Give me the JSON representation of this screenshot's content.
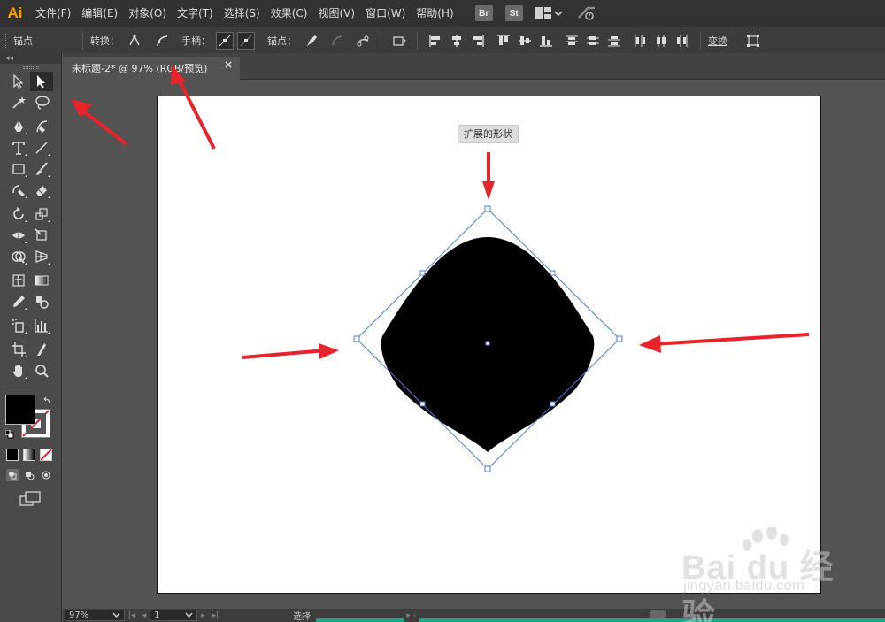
{
  "app": {
    "logo": "Ai"
  },
  "menu": [
    "文件(F)",
    "编辑(E)",
    "对象(O)",
    "文字(T)",
    "选择(S)",
    "效果(C)",
    "视图(V)",
    "窗口(W)",
    "帮助(H)"
  ],
  "bridge_buttons": [
    "Br",
    "St"
  ],
  "control_bar": {
    "mode_label": "锚点",
    "convert_label": "转换：",
    "handles_label": "手柄：",
    "anchors_label": "锚点：",
    "transform_label": "变换"
  },
  "document": {
    "tab_title": "未标题-2* @ 97% (RGB/预览)",
    "close_glyph": "×"
  },
  "tooltip": "扩展的形状",
  "status_bar": {
    "zoom": "97%",
    "artboard_num": "1",
    "tool_label": "选择"
  },
  "colors": {
    "accent": "#ff9a00",
    "arrow_red": "#e8232a",
    "selection_blue": "#4a7bd6",
    "fill": "#000000"
  },
  "icons": {
    "tools": [
      [
        "selection-arrow-icon",
        "direct-selection-icon"
      ],
      [
        "magic-wand-icon",
        "lasso-icon"
      ],
      [
        "pen-icon",
        "curvature-icon"
      ],
      [
        "type-icon",
        "line-segment-icon"
      ],
      [
        "rectangle-icon",
        "paintbrush-icon"
      ],
      [
        "shaper-icon",
        "eraser-icon"
      ],
      [
        "rotate-icon",
        "scale-icon"
      ],
      [
        "width-icon",
        "free-transform-icon"
      ],
      [
        "shape-builder-icon",
        "perspective-grid-icon"
      ],
      [
        "mesh-icon",
        "gradient-icon"
      ],
      [
        "eyedropper-icon",
        "blend-icon"
      ],
      [
        "symbol-sprayer-icon",
        "graph-icon"
      ],
      [
        "artboard-icon",
        "slice-icon"
      ],
      [
        "hand-icon",
        "zoom-icon"
      ]
    ]
  },
  "watermark": {
    "logo": "Bai du 经验",
    "url": "jingyan.baidu.com"
  }
}
